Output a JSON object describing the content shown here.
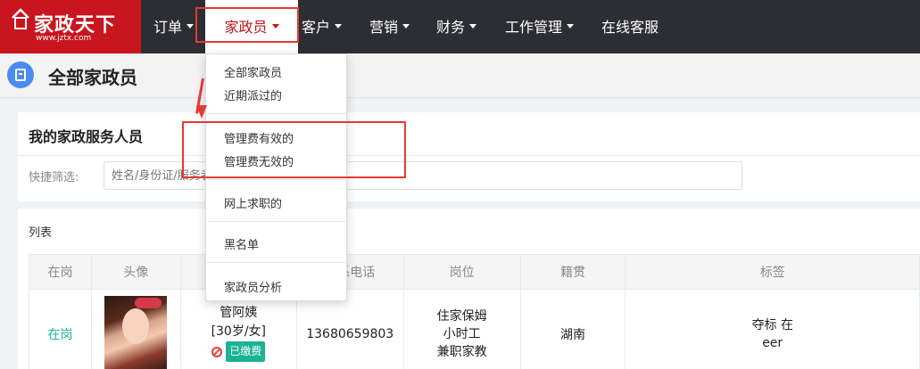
{
  "app": {
    "brand": "家政天下",
    "url": "www.jztx.com"
  },
  "nav": {
    "items": [
      {
        "label": "订单",
        "caret": true
      },
      {
        "label": "家政员",
        "caret": true,
        "active": true
      },
      {
        "label": "客户",
        "caret": true
      },
      {
        "label": "营销",
        "caret": true
      },
      {
        "label": "财务",
        "caret": true
      },
      {
        "label": "工作管理",
        "caret": true
      },
      {
        "label": "在线客服",
        "caret": false
      }
    ]
  },
  "page": {
    "title": "全部家政员",
    "title_icon": "book-icon"
  },
  "filter_panel": {
    "heading": "我的家政服务人员",
    "quick_filter_label": "快捷筛选:",
    "search_placeholder": "姓名/身份证/服务者"
  },
  "list_panel": {
    "label": "列表",
    "columns": [
      "在岗",
      "头像",
      "",
      "联系电话",
      "岗位",
      "籍贯",
      "标签"
    ],
    "rows": [
      {
        "status": "在岗",
        "name": "管阿姨",
        "age_gender": "[30岁/女]",
        "badge": "已缴费",
        "phone": "13680659803",
        "positions": [
          "住家保姆",
          "小时工",
          "兼职家教"
        ],
        "hometown": "湖南",
        "tags": [
          "夺标 在",
          "eer"
        ]
      }
    ]
  },
  "dropdown": {
    "groups": [
      [
        "全部家政员",
        "近期派过的"
      ],
      [
        "管理费有效的",
        "管理费无效的"
      ],
      [
        "网上求职的"
      ],
      [
        "黑名单"
      ],
      [
        "家政员分析"
      ]
    ]
  },
  "colors": {
    "topbar": "#2d2e33",
    "logo_red": "#c9151e",
    "accent_green": "#1ab394",
    "annotation_red": "#e53935",
    "title_icon_blue": "#4a8cf0"
  }
}
